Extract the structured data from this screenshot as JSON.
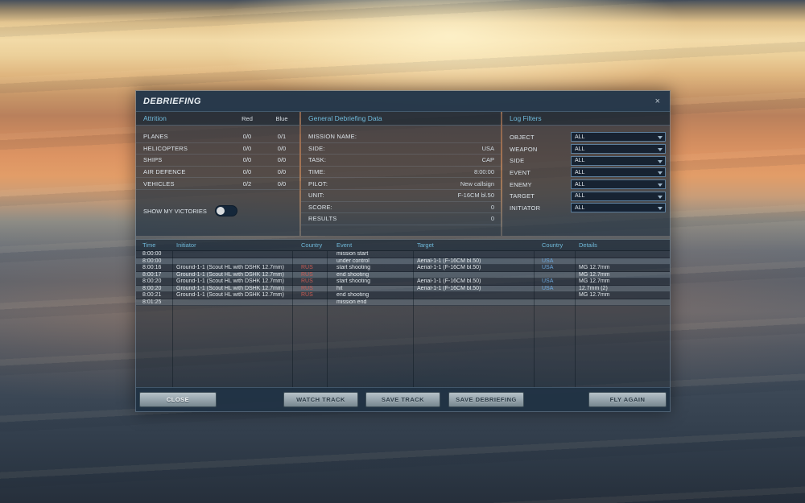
{
  "window": {
    "title": "DEBRIEFING",
    "close_icon": "×"
  },
  "attrition": {
    "title": "Attrition",
    "col_red": "Red",
    "col_blue": "Blue",
    "rows": [
      {
        "label": "PLANES",
        "red": "0/0",
        "blue": "0/1"
      },
      {
        "label": "HELICOPTERS",
        "red": "0/0",
        "blue": "0/0"
      },
      {
        "label": "SHIPS",
        "red": "0/0",
        "blue": "0/0"
      },
      {
        "label": "AIR DEFENCE",
        "red": "0/0",
        "blue": "0/0"
      },
      {
        "label": "VEHICLES",
        "red": "0/2",
        "blue": "0/0"
      }
    ],
    "show_my_victories_label": "SHOW MY VICTORIES",
    "show_my_victories_state": "off"
  },
  "general": {
    "title": "General Debriefing Data",
    "fields": [
      {
        "label": "MISSION NAME:",
        "value": ""
      },
      {
        "label": "SIDE:",
        "value": "USA"
      },
      {
        "label": "TASK:",
        "value": "CAP"
      },
      {
        "label": "TIME:",
        "value": "8:00:00"
      },
      {
        "label": "PILOT:",
        "value": "New callsign"
      },
      {
        "label": "UNIT:",
        "value": "F-16CM bl.50"
      },
      {
        "label": "SCORE:",
        "value": "0"
      },
      {
        "label": "RESULTS",
        "value": "0"
      }
    ]
  },
  "log_filters": {
    "title": "Log Filters",
    "filters": [
      {
        "label": "OBJECT",
        "value": "ALL"
      },
      {
        "label": "WEAPON",
        "value": "ALL"
      },
      {
        "label": "SIDE",
        "value": "ALL"
      },
      {
        "label": "EVENT",
        "value": "ALL"
      },
      {
        "label": "ENEMY",
        "value": "ALL"
      },
      {
        "label": "TARGET",
        "value": "ALL"
      },
      {
        "label": "INITIATOR",
        "value": "ALL"
      }
    ]
  },
  "log_table": {
    "headers": {
      "time": "Time",
      "initiator": "Initiator",
      "country": "Country",
      "event": "Event",
      "target": "Target",
      "country2": "Country",
      "details": "Details"
    },
    "rows": [
      {
        "time": "8:00:00",
        "initiator": "",
        "country": "",
        "event": "mission start",
        "target": "",
        "target_country": "",
        "details": ""
      },
      {
        "time": "8:00:00",
        "initiator": "",
        "country": "",
        "event": "under control",
        "target": "Aerial-1-1 (F-16CM bl.50)",
        "target_country": "USA",
        "details": ""
      },
      {
        "time": "8:00:16",
        "initiator": "Ground-1-1 (Scout HL with DSHK 12.7mm)",
        "country": "RUS",
        "event": "start shooting",
        "target": "Aerial-1-1 (F-16CM bl.50)",
        "target_country": "USA",
        "details": "MG 12.7mm"
      },
      {
        "time": "8:00:17",
        "initiator": "Ground-1-1 (Scout HL with DSHK 12.7mm)",
        "country": "RUS",
        "event": "end shooting",
        "target": "",
        "target_country": "",
        "details": "MG 12.7mm"
      },
      {
        "time": "8:00:20",
        "initiator": "Ground-1-1 (Scout HL with DSHK 12.7mm)",
        "country": "RUS",
        "event": "start shooting",
        "target": "Aerial-1-1 (F-16CM bl.50)",
        "target_country": "USA",
        "details": "MG 12.7mm"
      },
      {
        "time": "8:00:20",
        "initiator": "Ground-1-1 (Scout HL with DSHK 12.7mm)",
        "country": "RUS",
        "event": "hit",
        "target": "Aerial-1-1 (F-16CM bl.50)",
        "target_country": "USA",
        "details": "12.7mm (2)"
      },
      {
        "time": "8:00:21",
        "initiator": "Ground-1-1 (Scout HL with DSHK 12.7mm)",
        "country": "RUS",
        "event": "end shooting",
        "target": "",
        "target_country": "",
        "details": "MG 12.7mm"
      },
      {
        "time": "8:01:25",
        "initiator": "",
        "country": "",
        "event": "mission end",
        "target": "",
        "target_country": "",
        "details": ""
      }
    ]
  },
  "buttons": {
    "close": "CLOSE",
    "watch_track": "WATCH TRACK",
    "save_track": "SAVE TRACK",
    "save_debriefing": "SAVE DEBRIEFING",
    "fly_again": "FLY AGAIN"
  },
  "colors": {
    "accent_cyan": "#6fb9da",
    "country_red": "#c75b52",
    "country_blue": "#6aa4d8",
    "panel_bg": "#1e2f40"
  }
}
